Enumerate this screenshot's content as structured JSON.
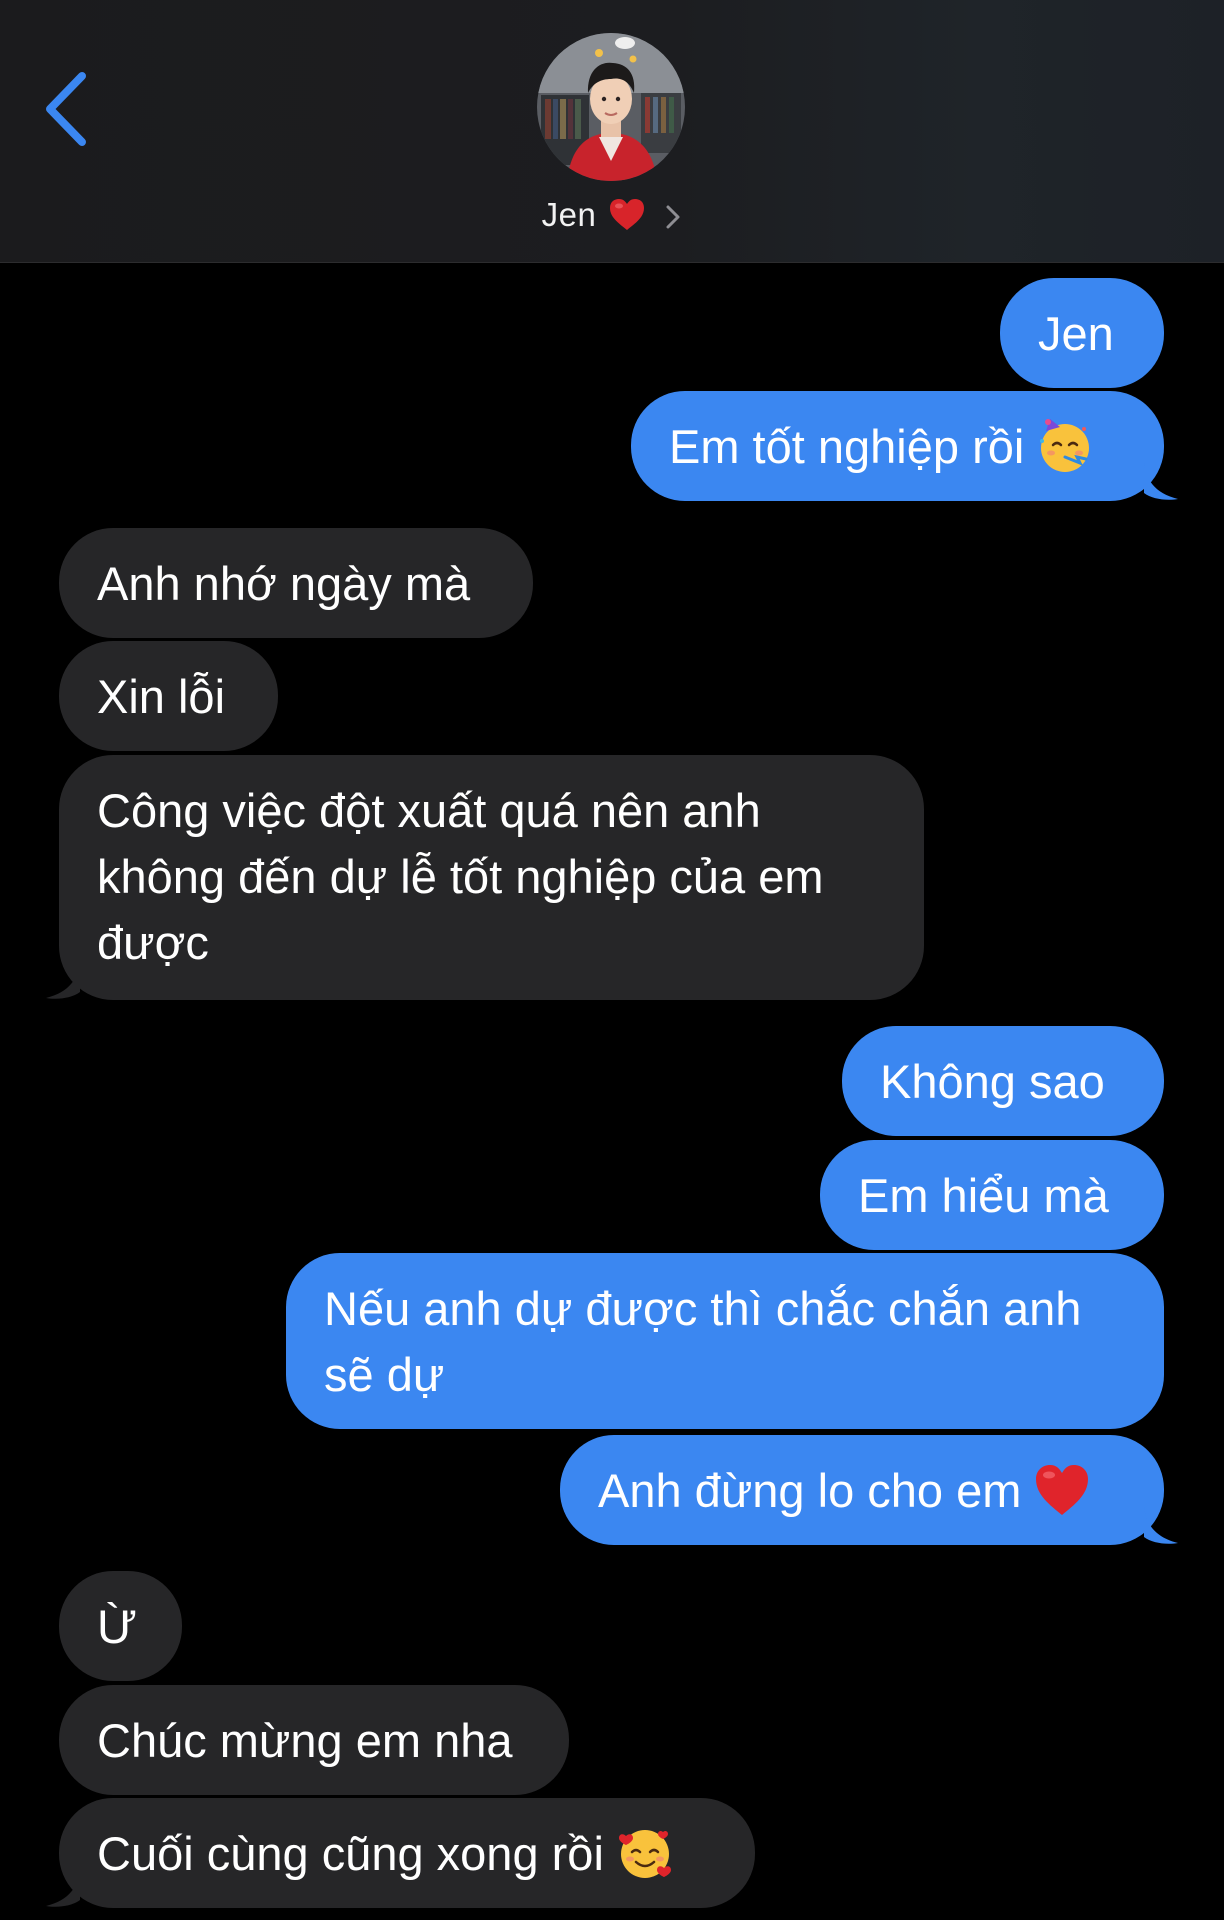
{
  "header": {
    "contact_name": "Jen",
    "icons": {
      "back": "chevron-left-icon",
      "name_emoji": "red-heart-icon",
      "details": "chevron-right-icon"
    },
    "accent_color": "#3b87f1"
  },
  "messages": [
    {
      "direction": "outgoing",
      "text": "Jen"
    },
    {
      "direction": "outgoing",
      "text": "Em tốt nghiệp rồi",
      "emoji": "partying-face-icon"
    },
    {
      "direction": "incoming",
      "text": "Anh nhớ ngày mà"
    },
    {
      "direction": "incoming",
      "text": "Xin lỗi"
    },
    {
      "direction": "incoming",
      "text": "Công việc đột xuất quá nên anh không đến dự lễ tốt nghiệp của em được"
    },
    {
      "direction": "outgoing",
      "text": "Không sao"
    },
    {
      "direction": "outgoing",
      "text": "Em hiểu mà"
    },
    {
      "direction": "outgoing",
      "text": "Nếu anh dự được thì chắc chắn anh sẽ dự"
    },
    {
      "direction": "outgoing",
      "text": "Anh đừng lo cho em",
      "emoji": "red-heart-icon"
    },
    {
      "direction": "incoming",
      "text": "Ừ"
    },
    {
      "direction": "incoming",
      "text": "Chúc mừng em nha"
    },
    {
      "direction": "incoming",
      "text": "Cuối cùng cũng xong rồi",
      "emoji": "smiling-face-with-hearts-icon"
    }
  ],
  "colors": {
    "outgoing_bubble": "#3b87f1",
    "incoming_bubble": "#262628",
    "background": "#000000"
  }
}
